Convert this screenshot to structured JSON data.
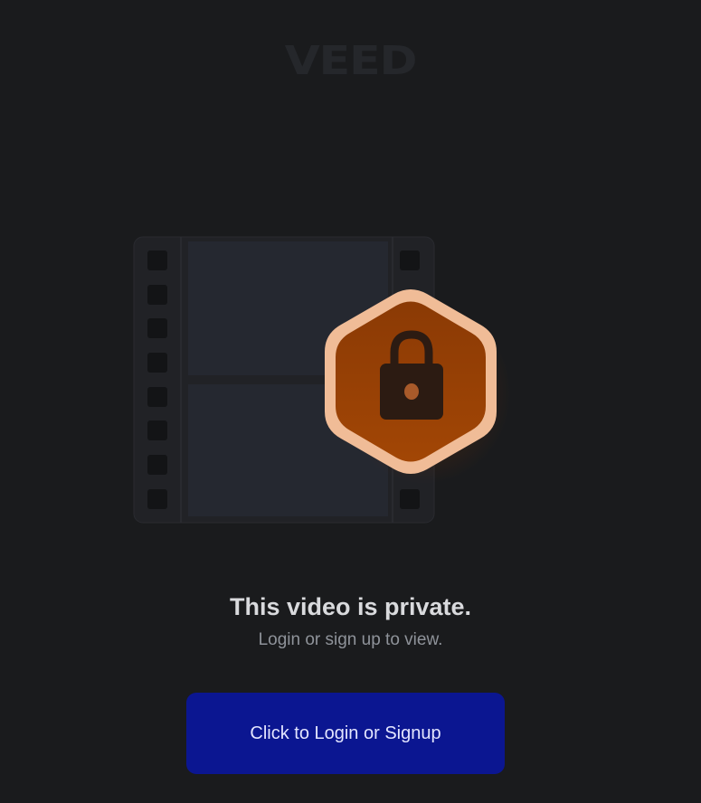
{
  "brand": {
    "logo_text": "VEED"
  },
  "illustration": {
    "film_icon": "film-strip-icon",
    "lock_icon": "lock-icon"
  },
  "message": {
    "title": "This video is private.",
    "subtitle": "Login or sign up to view."
  },
  "actions": {
    "login_button_label": "Click to Login or Signup"
  },
  "colors": {
    "background": "#1a1b1d",
    "button": "#0b1691",
    "hexagon_fill": "#8e3d06",
    "hexagon_border": "#f0bc97",
    "lock": "#2c1b12"
  }
}
